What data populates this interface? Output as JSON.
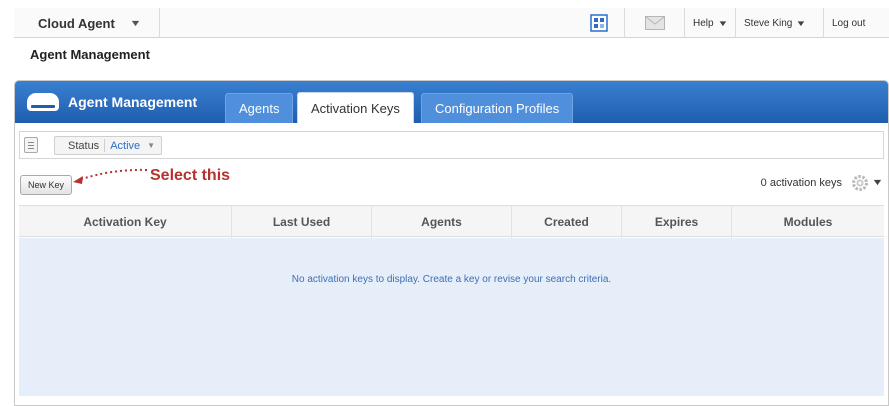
{
  "topbar": {
    "app_name": "Cloud Agent",
    "help_label": "Help",
    "user_label": "Steve King",
    "logout_label": "Log out"
  },
  "page": {
    "title": "Agent Management"
  },
  "panel": {
    "brand": "Agent Management",
    "tabs": [
      {
        "label": "Agents",
        "active": false
      },
      {
        "label": "Activation Keys",
        "active": true
      },
      {
        "label": "Configuration Profiles",
        "active": false
      }
    ]
  },
  "filter": {
    "label": "Status",
    "value": "Active"
  },
  "actions": {
    "new_key_label": "New Key",
    "annotation": "Select this",
    "count_label": "0 activation keys"
  },
  "table": {
    "columns": [
      "Activation Key",
      "Last Used",
      "Agents",
      "Created",
      "Expires",
      "Modules"
    ],
    "empty_message": "No activation keys to display. Create a key or revise your search criteria."
  },
  "colors": {
    "header_blue": "#2b6dc2",
    "annotation_red": "#b5322f",
    "empty_body": "#e6eef9"
  }
}
